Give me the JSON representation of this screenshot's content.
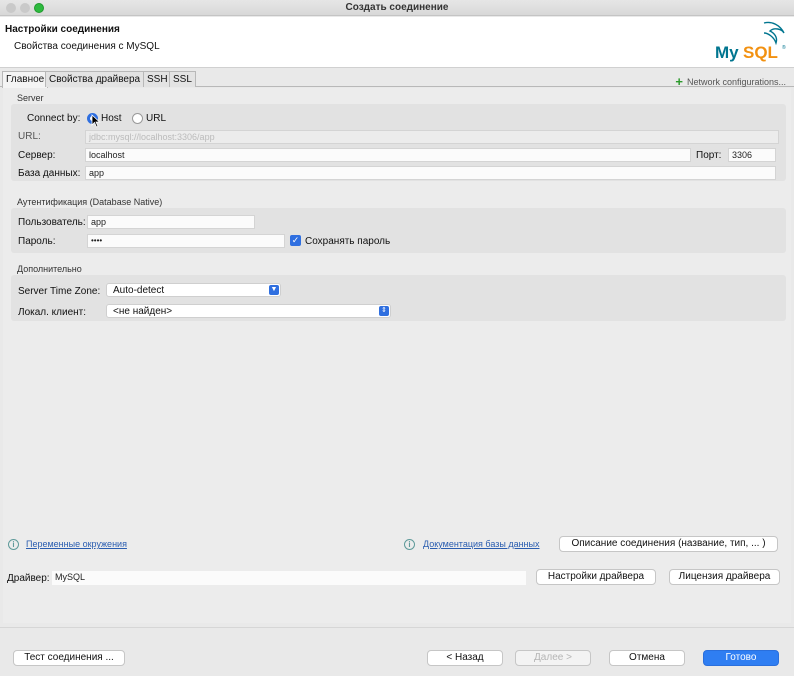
{
  "window": {
    "title": "Создать соединение"
  },
  "header": {
    "title": "Настройки соединения",
    "subtitle": "Свойства соединения с MySQL",
    "logo_text": "MySQL"
  },
  "tabs": [
    {
      "label": "Главное",
      "active": true
    },
    {
      "label": "Свойства драйвера",
      "active": false
    },
    {
      "label": "SSH",
      "active": false
    },
    {
      "label": "SSL",
      "active": false
    }
  ],
  "network_config": {
    "label": "Network configurations...",
    "icon": "plus-icon"
  },
  "server": {
    "group_label": "Server",
    "connect_by_label": "Connect by:",
    "host_option": "Host",
    "url_option": "URL",
    "selected": "Host",
    "url_label": "URL:",
    "url_value": "jdbc:mysql://localhost:3306/app",
    "server_label": "Сервер:",
    "server_value": "localhost",
    "port_label": "Порт:",
    "port_value": "3306",
    "database_label": "База данных:",
    "database_value": "app"
  },
  "auth": {
    "group_label": "Аутентификация (Database Native)",
    "user_label": "Пользователь:",
    "user_value": "app",
    "password_label": "Пароль:",
    "password_value": "••••",
    "save_password_label": "Сохранять пароль",
    "save_password_checked": true
  },
  "advanced": {
    "group_label": "Дополнительно",
    "timezone_label": "Server Time Zone:",
    "timezone_value": "Auto-detect",
    "client_label": "Локал. клиент:",
    "client_value": "<не найден>"
  },
  "links": {
    "env_vars": "Переменные окружения",
    "db_docs": "Документация базы данных",
    "describe_button": "Описание соединения (название, тип, ... )"
  },
  "driver": {
    "label": "Драйвер:",
    "value": "MySQL",
    "settings_button": "Настройки драйвера",
    "license_button": "Лицензия драйвера"
  },
  "footer": {
    "test_button": "Тест соединения ...",
    "back_button": "< Назад",
    "next_button": "Далее >",
    "cancel_button": "Отмена",
    "finish_button": "Готово"
  },
  "colors": {
    "accent": "#2f7ef2",
    "link": "#2a5db0",
    "mysql_blue": "#00758f",
    "mysql_orange": "#f29111"
  }
}
